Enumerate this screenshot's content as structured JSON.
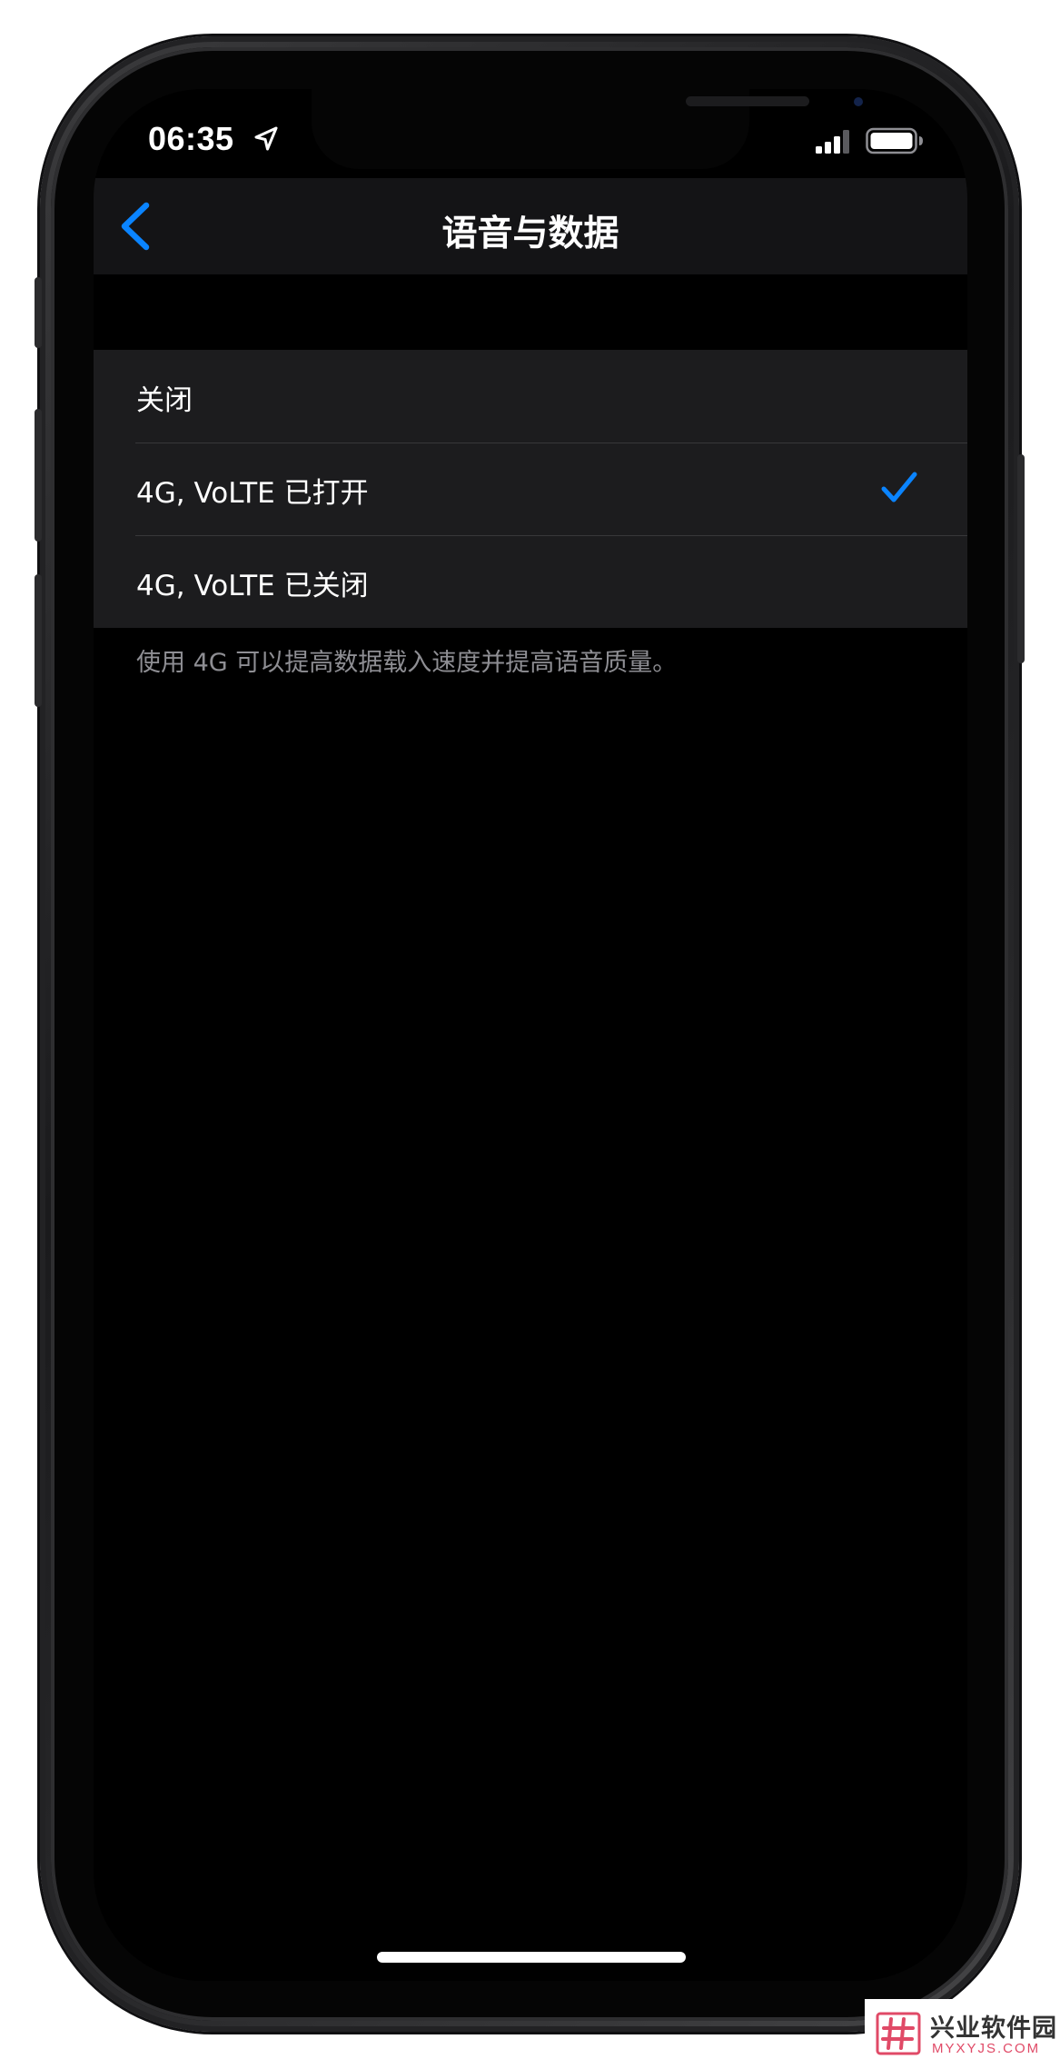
{
  "status_bar": {
    "time": "06:35"
  },
  "nav": {
    "title": "语音与数据"
  },
  "options": [
    {
      "label": "关闭",
      "selected": false
    },
    {
      "label": "4G, VoLTE 已打开",
      "selected": true
    },
    {
      "label": "4G, VoLTE 已关闭",
      "selected": false
    }
  ],
  "footer_note": "使用 4G 可以提高数据载入速度并提高语音质量。",
  "watermark": {
    "title": "兴业软件园",
    "domain": "MYXYJS.COM"
  },
  "colors": {
    "accent": "#0a84ff",
    "background": "#000000",
    "group_background": "#1c1c1e",
    "nav_background": "#141416",
    "secondary_text": "#8e8e93",
    "watermark_accent": "#e04a67"
  },
  "icons": [
    "location-arrow-icon",
    "cellular-signal-icon",
    "battery-icon",
    "back-chevron-icon",
    "checkmark-icon",
    "watermark-logo-icon"
  ]
}
